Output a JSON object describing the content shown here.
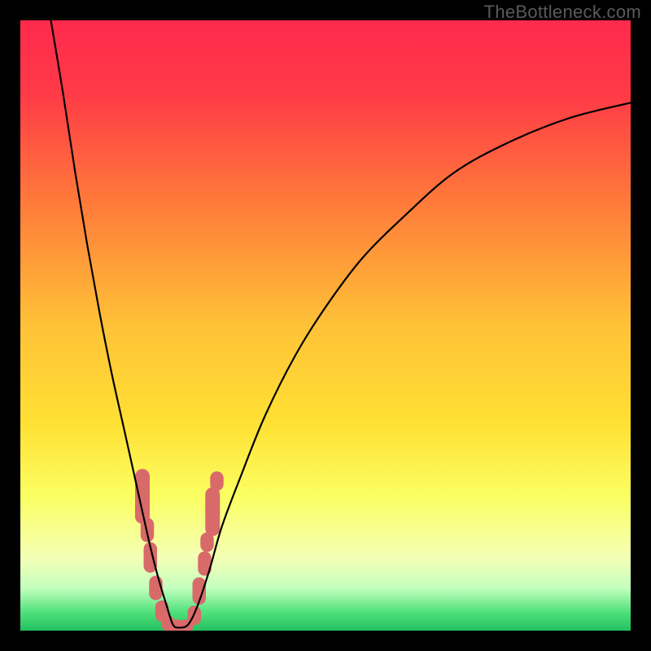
{
  "watermark": "TheBottleneck.com",
  "chart_data": {
    "type": "line",
    "title": "",
    "xlabel": "",
    "ylabel": "",
    "xlim": [
      0,
      100
    ],
    "ylim": [
      0,
      100
    ],
    "gradient_stops": [
      {
        "pct": 0,
        "color": "#ff2a4d"
      },
      {
        "pct": 12,
        "color": "#ff3a47"
      },
      {
        "pct": 30,
        "color": "#ff7b3a"
      },
      {
        "pct": 50,
        "color": "#ffc238"
      },
      {
        "pct": 66,
        "color": "#ffe033"
      },
      {
        "pct": 78,
        "color": "#fbff62"
      },
      {
        "pct": 88,
        "color": "#f4ffb5"
      },
      {
        "pct": 93,
        "color": "#c4ffbf"
      },
      {
        "pct": 97,
        "color": "#4fe17a"
      },
      {
        "pct": 100,
        "color": "#22c060"
      }
    ],
    "series": [
      {
        "name": "bottleneck-curve",
        "color": "#000000",
        "width": 2.2,
        "x": [
          5,
          7,
          9,
          11,
          13,
          15,
          17,
          19,
          21,
          22.5,
          24,
          25,
          26,
          27.5,
          29,
          31,
          33,
          36,
          40,
          45,
          50,
          56,
          63,
          71,
          80,
          90,
          100
        ],
        "y": [
          100,
          88,
          75,
          63,
          52,
          42,
          33,
          24,
          15,
          9,
          4,
          1,
          0.5,
          1,
          4,
          10,
          17,
          25,
          35,
          45,
          53,
          61,
          68,
          75,
          80,
          84,
          86.5
        ]
      }
    ],
    "markers": {
      "name": "range-markers",
      "color": "#d96a6a",
      "shape": "rounded-rect",
      "points": [
        {
          "x": 20.0,
          "y": 22,
          "w": 2.4,
          "h": 9
        },
        {
          "x": 20.8,
          "y": 16.5,
          "w": 2.2,
          "h": 4
        },
        {
          "x": 21.3,
          "y": 12,
          "w": 2.2,
          "h": 5
        },
        {
          "x": 22.2,
          "y": 7,
          "w": 2.2,
          "h": 4
        },
        {
          "x": 23.2,
          "y": 3.2,
          "w": 2.2,
          "h": 3.5
        },
        {
          "x": 24.2,
          "y": 1.2,
          "w": 2.2,
          "h": 2.6
        },
        {
          "x": 25.4,
          "y": 0.7,
          "w": 3.0,
          "h": 2.2
        },
        {
          "x": 27.0,
          "y": 0.7,
          "w": 2.6,
          "h": 2.2
        },
        {
          "x": 28.5,
          "y": 2.5,
          "w": 2.2,
          "h": 3.2
        },
        {
          "x": 29.3,
          "y": 6.5,
          "w": 2.2,
          "h": 4.5
        },
        {
          "x": 30.2,
          "y": 11,
          "w": 2.2,
          "h": 4
        },
        {
          "x": 30.6,
          "y": 14.5,
          "w": 2.2,
          "h": 3.2
        },
        {
          "x": 31.5,
          "y": 19.5,
          "w": 2.4,
          "h": 8
        },
        {
          "x": 32.2,
          "y": 24.5,
          "w": 2.2,
          "h": 3.2
        }
      ]
    }
  }
}
